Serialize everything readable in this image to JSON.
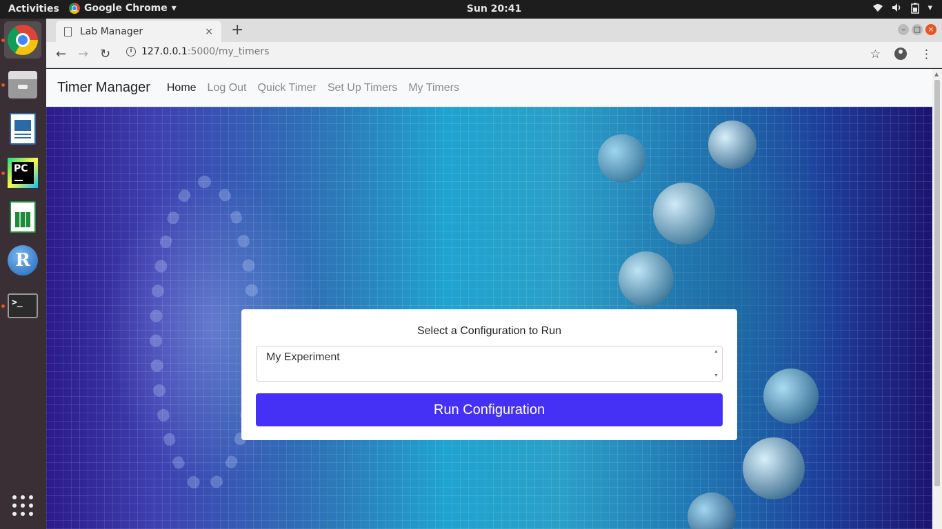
{
  "system": {
    "activities": "Activities",
    "app_name": "Google Chrome",
    "clock": "Sun 20:41",
    "tray": {
      "wifi": "wifi-icon",
      "volume": "volume-icon",
      "battery": "battery-icon",
      "menu": "▾"
    }
  },
  "dock": {
    "items": [
      {
        "name": "chrome",
        "running": true
      },
      {
        "name": "files",
        "running": true
      },
      {
        "name": "libreoffice-impress",
        "running": false
      },
      {
        "name": "pycharm",
        "running": true
      },
      {
        "name": "libreoffice-calc",
        "running": false
      },
      {
        "name": "r",
        "running": false
      },
      {
        "name": "terminal",
        "running": true
      }
    ],
    "pycharm_label": "PC",
    "r_label": "R",
    "terminal_label": ">_"
  },
  "browser": {
    "tab_title": "Lab Manager",
    "tab_close": "×",
    "new_tab": "+",
    "back": "←",
    "forward": "→",
    "reload": "↻",
    "url_host": "127.0.0.1",
    "url_path": ":5000/my_timers",
    "bookmark": "☆",
    "menu": "⋮"
  },
  "navbar": {
    "brand": "Timer Manager",
    "links": [
      "Home",
      "Log Out",
      "Quick Timer",
      "Set Up Timers",
      "My Timers"
    ],
    "active_index": 0
  },
  "card": {
    "title": "Select a Configuration to Run",
    "selected_option": "My Experiment",
    "button_label": "Run Configuration"
  },
  "colors": {
    "accent": "#4530f6",
    "ubuntu_orange": "#e95420",
    "navbar_bg": "#f8f9fa"
  }
}
